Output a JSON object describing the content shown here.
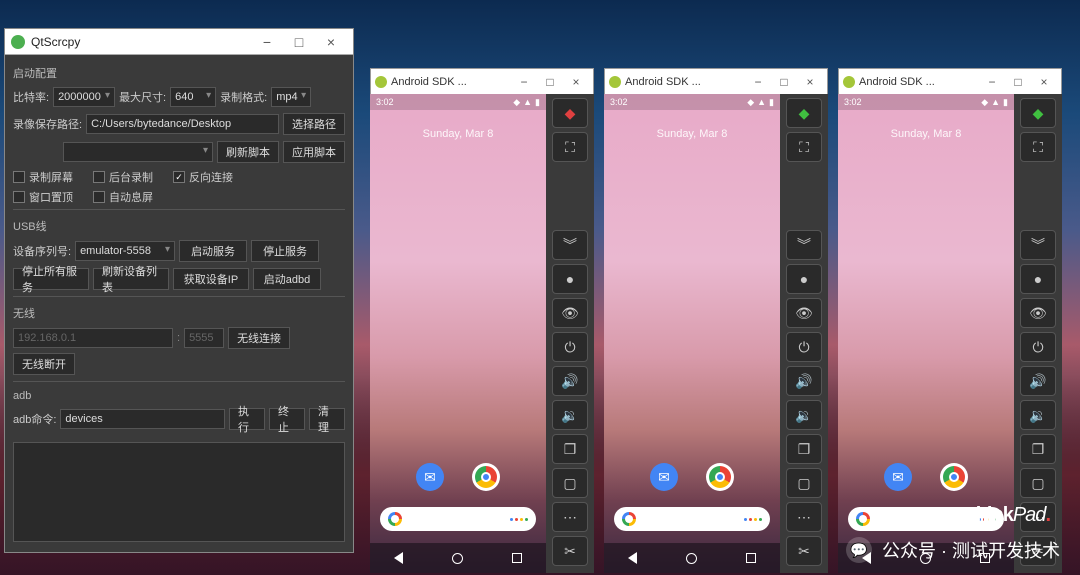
{
  "qt": {
    "title": "QtScrcpy",
    "section_launch": "启动配置",
    "bitrate_label": "比特率:",
    "bitrate_value": "2000000",
    "maxsize_label": "最大尺寸:",
    "maxsize_value": "640",
    "format_label": "录制格式:",
    "format_value": "mp4",
    "savepath_label": "录像保存路径:",
    "savepath_value": "C:/Users/bytedance/Desktop",
    "choose_path_btn": "选择路径",
    "refresh_script_btn": "刷新脚本",
    "apply_script_btn": "应用脚本",
    "cb_record": "录制屏幕",
    "cb_background": "后台录制",
    "cb_reverse": "反向连接",
    "cb_top": "窗口置顶",
    "cb_autooff": "自动息屏",
    "section_usb": "USB线",
    "serial_label": "设备序列号:",
    "serial_value": "emulator-5558",
    "start_service_btn": "启动服务",
    "stop_service_btn": "停止服务",
    "stop_all_btn": "停止所有服务",
    "refresh_devices_btn": "刷新设备列表",
    "get_ip_btn": "获取设备IP",
    "start_adbd_btn": "启动adbd",
    "section_wireless": "无线",
    "ip_placeholder": "192.168.0.1",
    "port_placeholder": "5555",
    "wifi_connect_btn": "无线连接",
    "wifi_disconnect_btn": "无线断开",
    "section_adb": "adb",
    "adb_label": "adb命令:",
    "adb_value": "devices",
    "exec_btn": "执行",
    "stop_btn": "终止",
    "clear_btn": "清理"
  },
  "android": {
    "title": "Android SDK ...",
    "time": "3:02",
    "date": "Sunday, Mar 8"
  },
  "overlay": {
    "brand_think": "Think",
    "brand_pad": "Pad",
    "wechat_text": "公众号 · 测试开发技术"
  }
}
